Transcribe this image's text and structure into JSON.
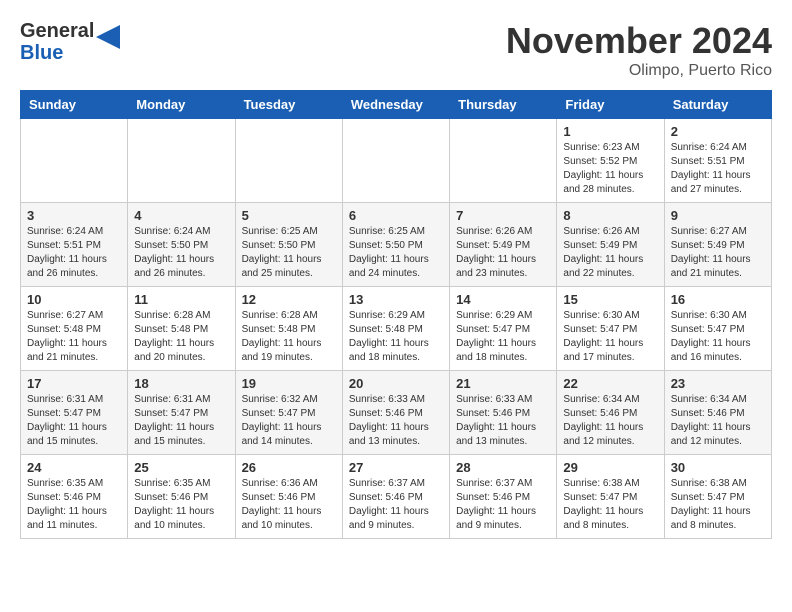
{
  "header": {
    "logo_line1": "General",
    "logo_line2": "Blue",
    "month": "November 2024",
    "location": "Olimpo, Puerto Rico"
  },
  "weekdays": [
    "Sunday",
    "Monday",
    "Tuesday",
    "Wednesday",
    "Thursday",
    "Friday",
    "Saturday"
  ],
  "weeks": [
    [
      {
        "day": "",
        "info": ""
      },
      {
        "day": "",
        "info": ""
      },
      {
        "day": "",
        "info": ""
      },
      {
        "day": "",
        "info": ""
      },
      {
        "day": "",
        "info": ""
      },
      {
        "day": "1",
        "info": "Sunrise: 6:23 AM\nSunset: 5:52 PM\nDaylight: 11 hours\nand 28 minutes."
      },
      {
        "day": "2",
        "info": "Sunrise: 6:24 AM\nSunset: 5:51 PM\nDaylight: 11 hours\nand 27 minutes."
      }
    ],
    [
      {
        "day": "3",
        "info": "Sunrise: 6:24 AM\nSunset: 5:51 PM\nDaylight: 11 hours\nand 26 minutes."
      },
      {
        "day": "4",
        "info": "Sunrise: 6:24 AM\nSunset: 5:50 PM\nDaylight: 11 hours\nand 26 minutes."
      },
      {
        "day": "5",
        "info": "Sunrise: 6:25 AM\nSunset: 5:50 PM\nDaylight: 11 hours\nand 25 minutes."
      },
      {
        "day": "6",
        "info": "Sunrise: 6:25 AM\nSunset: 5:50 PM\nDaylight: 11 hours\nand 24 minutes."
      },
      {
        "day": "7",
        "info": "Sunrise: 6:26 AM\nSunset: 5:49 PM\nDaylight: 11 hours\nand 23 minutes."
      },
      {
        "day": "8",
        "info": "Sunrise: 6:26 AM\nSunset: 5:49 PM\nDaylight: 11 hours\nand 22 minutes."
      },
      {
        "day": "9",
        "info": "Sunrise: 6:27 AM\nSunset: 5:49 PM\nDaylight: 11 hours\nand 21 minutes."
      }
    ],
    [
      {
        "day": "10",
        "info": "Sunrise: 6:27 AM\nSunset: 5:48 PM\nDaylight: 11 hours\nand 21 minutes."
      },
      {
        "day": "11",
        "info": "Sunrise: 6:28 AM\nSunset: 5:48 PM\nDaylight: 11 hours\nand 20 minutes."
      },
      {
        "day": "12",
        "info": "Sunrise: 6:28 AM\nSunset: 5:48 PM\nDaylight: 11 hours\nand 19 minutes."
      },
      {
        "day": "13",
        "info": "Sunrise: 6:29 AM\nSunset: 5:48 PM\nDaylight: 11 hours\nand 18 minutes."
      },
      {
        "day": "14",
        "info": "Sunrise: 6:29 AM\nSunset: 5:47 PM\nDaylight: 11 hours\nand 18 minutes."
      },
      {
        "day": "15",
        "info": "Sunrise: 6:30 AM\nSunset: 5:47 PM\nDaylight: 11 hours\nand 17 minutes."
      },
      {
        "day": "16",
        "info": "Sunrise: 6:30 AM\nSunset: 5:47 PM\nDaylight: 11 hours\nand 16 minutes."
      }
    ],
    [
      {
        "day": "17",
        "info": "Sunrise: 6:31 AM\nSunset: 5:47 PM\nDaylight: 11 hours\nand 15 minutes."
      },
      {
        "day": "18",
        "info": "Sunrise: 6:31 AM\nSunset: 5:47 PM\nDaylight: 11 hours\nand 15 minutes."
      },
      {
        "day": "19",
        "info": "Sunrise: 6:32 AM\nSunset: 5:47 PM\nDaylight: 11 hours\nand 14 minutes."
      },
      {
        "day": "20",
        "info": "Sunrise: 6:33 AM\nSunset: 5:46 PM\nDaylight: 11 hours\nand 13 minutes."
      },
      {
        "day": "21",
        "info": "Sunrise: 6:33 AM\nSunset: 5:46 PM\nDaylight: 11 hours\nand 13 minutes."
      },
      {
        "day": "22",
        "info": "Sunrise: 6:34 AM\nSunset: 5:46 PM\nDaylight: 11 hours\nand 12 minutes."
      },
      {
        "day": "23",
        "info": "Sunrise: 6:34 AM\nSunset: 5:46 PM\nDaylight: 11 hours\nand 12 minutes."
      }
    ],
    [
      {
        "day": "24",
        "info": "Sunrise: 6:35 AM\nSunset: 5:46 PM\nDaylight: 11 hours\nand 11 minutes."
      },
      {
        "day": "25",
        "info": "Sunrise: 6:35 AM\nSunset: 5:46 PM\nDaylight: 11 hours\nand 10 minutes."
      },
      {
        "day": "26",
        "info": "Sunrise: 6:36 AM\nSunset: 5:46 PM\nDaylight: 11 hours\nand 10 minutes."
      },
      {
        "day": "27",
        "info": "Sunrise: 6:37 AM\nSunset: 5:46 PM\nDaylight: 11 hours\nand 9 minutes."
      },
      {
        "day": "28",
        "info": "Sunrise: 6:37 AM\nSunset: 5:46 PM\nDaylight: 11 hours\nand 9 minutes."
      },
      {
        "day": "29",
        "info": "Sunrise: 6:38 AM\nSunset: 5:47 PM\nDaylight: 11 hours\nand 8 minutes."
      },
      {
        "day": "30",
        "info": "Sunrise: 6:38 AM\nSunset: 5:47 PM\nDaylight: 11 hours\nand 8 minutes."
      }
    ]
  ]
}
